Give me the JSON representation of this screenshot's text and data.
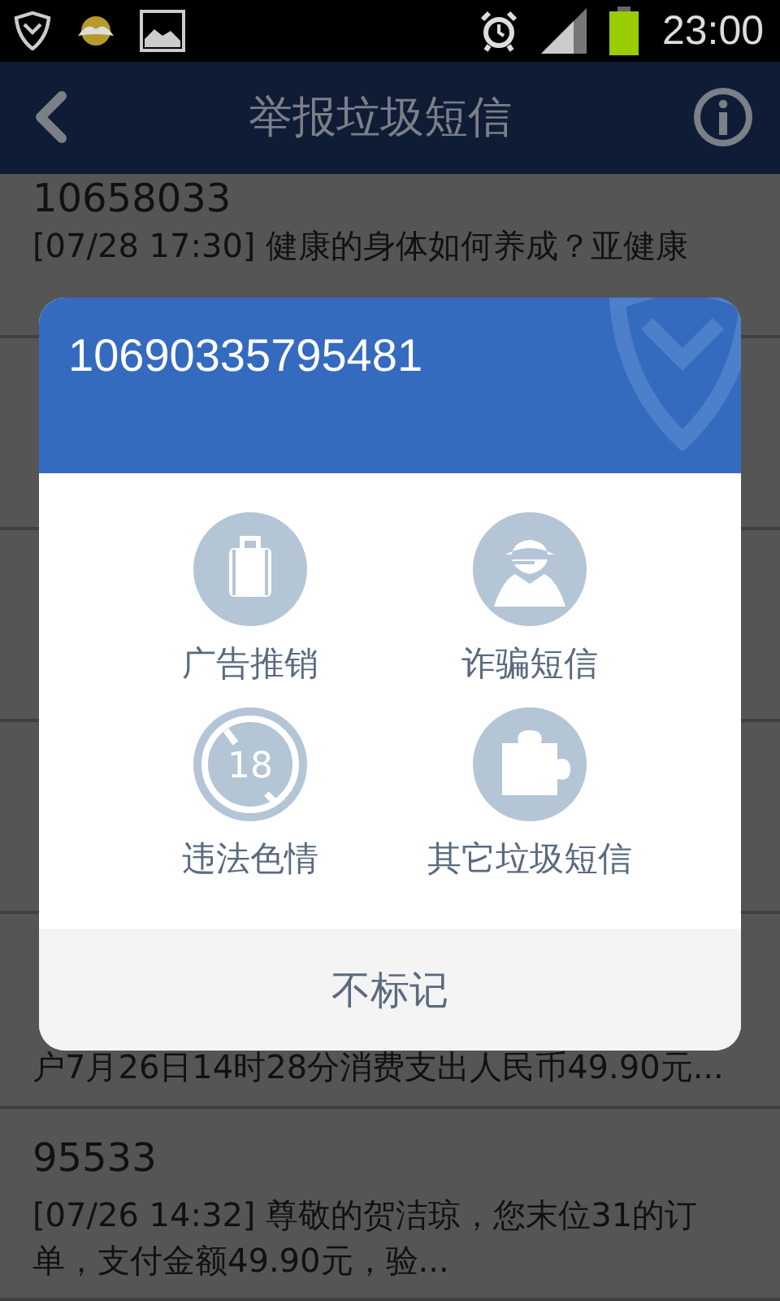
{
  "status_bar": {
    "time": "23:00"
  },
  "header": {
    "title": "举报垃圾短信"
  },
  "messages": [
    {
      "kind": "top",
      "sender": "10658033",
      "preview": "[07/28 17:30] 健康的身体如何养成？亚健康"
    },
    {
      "kind": "hidden"
    },
    {
      "kind": "hidden"
    },
    {
      "kind": "hidden"
    },
    {
      "kind": "tail",
      "preview": "户7月26日14时28分消费支出人民币49.90元..."
    },
    {
      "kind": "full",
      "sender": "95533",
      "preview": "[07/26 14:32] 尊敬的贺洁琼，您末位31的订单，支付金额49.90元，验..."
    }
  ],
  "dialog": {
    "number": "10690335795481",
    "options": [
      {
        "kind": "suitcase",
        "label": "广告推销"
      },
      {
        "kind": "spy",
        "label": "诈骗短信"
      },
      {
        "kind": "adult",
        "label": "违法色情",
        "badge": "18"
      },
      {
        "kind": "puzzle",
        "label": "其它垃圾短信"
      }
    ],
    "dismiss": "不标记"
  }
}
